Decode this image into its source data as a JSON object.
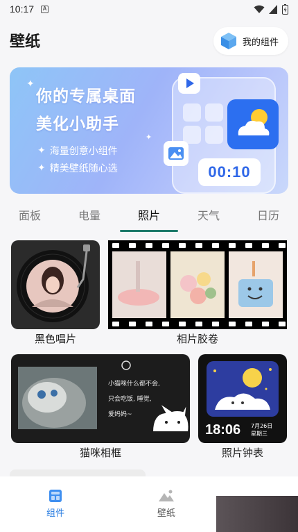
{
  "status": {
    "time": "10:17",
    "notif": "A"
  },
  "header": {
    "title": "壁纸",
    "widget_button": "我的组件"
  },
  "banner": {
    "title_line1": "你的专属桌面",
    "title_line2": "美化小助手",
    "bullet1": "海量创意小组件",
    "bullet2": "精美壁纸随心选",
    "clock_text": "00:10"
  },
  "tabs": [
    {
      "label": "面板",
      "active": false
    },
    {
      "label": "电量",
      "active": false
    },
    {
      "label": "照片",
      "active": true
    },
    {
      "label": "天气",
      "active": false
    },
    {
      "label": "日历",
      "active": false
    }
  ],
  "widgets": [
    {
      "label": "黑色唱片"
    },
    {
      "label": "相片胶卷"
    },
    {
      "label": "猫咪相框",
      "text_lines": [
        "小猫咪什么都不会,",
        "只会吃饭, 睡觉,",
        "爱妈妈~"
      ]
    },
    {
      "label": "照片钟表",
      "time": "18:06",
      "date": "7月26日",
      "weekday": "星期三"
    }
  ],
  "bottom_nav": [
    {
      "label": "组件",
      "icon": "widget-icon",
      "active": true
    },
    {
      "label": "壁纸",
      "icon": "wallpaper-icon",
      "active": false
    }
  ],
  "colors": {
    "accent": "#2a7de1",
    "tab_indicator": "#1d7a6a"
  }
}
